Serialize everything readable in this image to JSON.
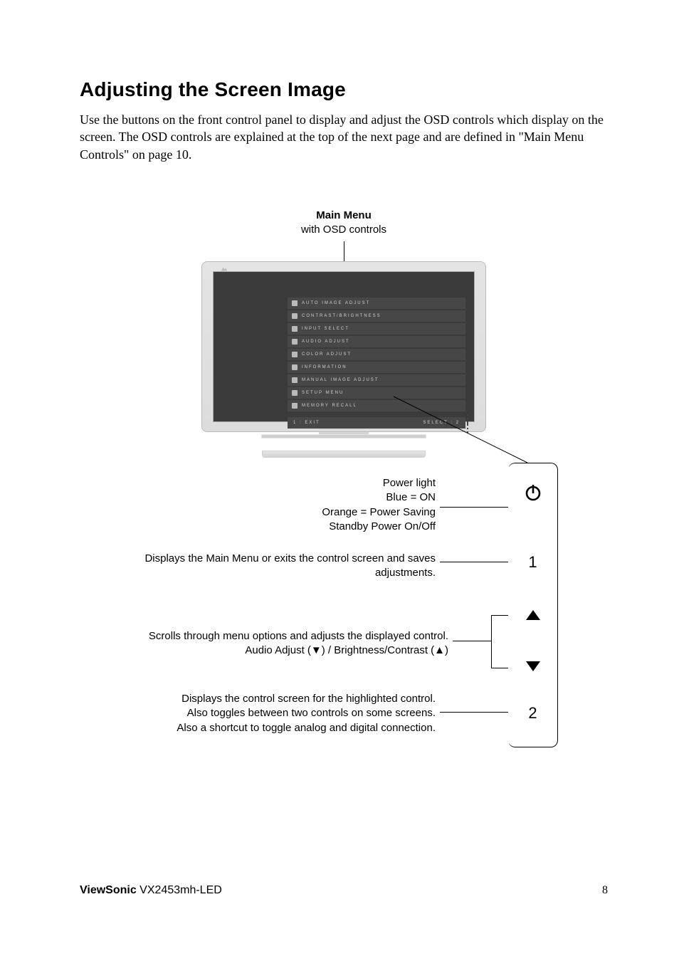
{
  "heading": "Adjusting the Screen Image",
  "intro": "Use the buttons on the front control panel to display and adjust the OSD controls which display on the screen. The OSD controls are explained at the top of the next page and are defined in \"Main Menu Controls\" on page 10.",
  "caption": {
    "title": "Main Menu",
    "subtitle": "with OSD controls"
  },
  "osd_items": [
    "AUTO IMAGE ADJUST",
    "CONTRAST/BRIGHTNESS",
    "INPUT SELECT",
    "AUDIO ADJUST",
    "COLOR ADJUST",
    "INFORMATION",
    "MANUAL IMAGE ADJUST",
    "SETUP MENU",
    "MEMORY RECALL"
  ],
  "osd_footer": {
    "left": "1 : EXIT",
    "right": "SELECT : 2"
  },
  "annotations": {
    "power": {
      "line1": "Power light",
      "line2": "Blue = ON",
      "line3": "Orange = Power Saving",
      "line4": "Standby Power On/Off"
    },
    "btn1": {
      "line1": "Displays the Main Menu or exits the control screen and saves",
      "line2": "adjustments."
    },
    "arrows": {
      "line1": "Scrolls through menu options and adjusts the displayed control.",
      "line2": "Audio Adjust (▼) / Brightness/Contrast  (▲)"
    },
    "btn2": {
      "line1": "Displays the control screen for the highlighted control.",
      "line2": "Also toggles between two controls on some screens.",
      "line3": "Also a shortcut to toggle analog and digital connection."
    }
  },
  "buttons": {
    "one": "1",
    "two": "2"
  },
  "footer": {
    "brand_bold": "ViewSonic",
    "brand_rest": "   VX2453mh-LED",
    "page": "8"
  }
}
